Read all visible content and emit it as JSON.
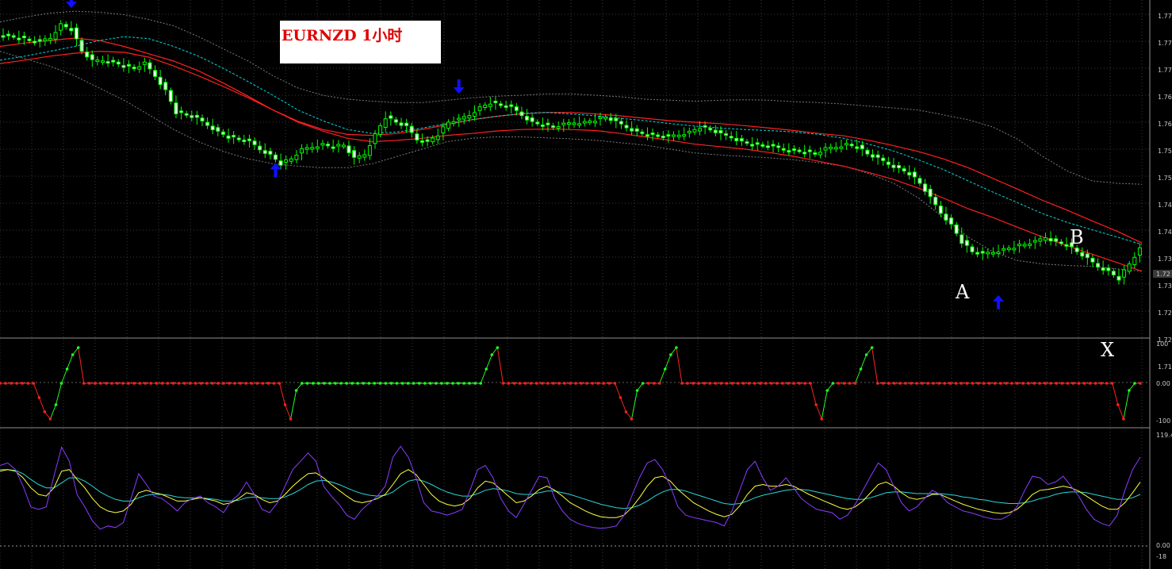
{
  "title": "EURNZD 1小时",
  "annotations": {
    "a": "A",
    "b": "B",
    "x": "X"
  },
  "colors": {
    "background": "#000000",
    "grid": "#3a3a3a",
    "candle": "#00ff00",
    "ma_red": "#ff2020",
    "ma_dashed": "#00d8d8",
    "bands": "#7a7a7a",
    "arrow": "#1010ff",
    "osc_red": "#ff2020",
    "osc_green": "#20ff20",
    "purple": "#8a3cff",
    "yellow": "#ffff40",
    "cyan": "#2ad6d6"
  },
  "chart_data": [
    {
      "type": "line",
      "name": "price",
      "title": "EURNZD 1小时",
      "y_ticks": [
        "1.77",
        "1.77",
        "1.77",
        "1.76",
        "1.76",
        "1.75",
        "1.75",
        "1.74",
        "1.74",
        "1.73",
        "1.73",
        "1.72",
        "1.72",
        "1.71"
      ],
      "current_price_label": "1.72",
      "price_path": [
        1.7725,
        1.7722,
        1.7718,
        1.7712,
        1.771,
        1.7718,
        1.7745,
        1.7735,
        1.769,
        1.767,
        1.7672,
        1.7668,
        1.766,
        1.7655,
        1.7665,
        1.764,
        1.761,
        1.7565,
        1.756,
        1.7552,
        1.754,
        1.7525,
        1.7515,
        1.751,
        1.7505,
        1.749,
        1.7478,
        1.746,
        1.747,
        1.7488,
        1.7495,
        1.75,
        1.7495,
        1.7498,
        1.747,
        1.748,
        1.752,
        1.7555,
        1.7545,
        1.7535,
        1.751,
        1.7505,
        1.752,
        1.7545,
        1.755,
        1.756,
        1.7575,
        1.7585,
        1.758,
        1.7575,
        1.756,
        1.7545,
        1.754,
        1.7535,
        1.754,
        1.7545,
        1.7545,
        1.755,
        1.7555,
        1.7545,
        1.7535,
        1.7525,
        1.752,
        1.7518,
        1.7515,
        1.752,
        1.7525,
        1.7535,
        1.753,
        1.752,
        1.7515,
        1.7505,
        1.75,
        1.7498,
        1.7495,
        1.749,
        1.7488,
        1.7485,
        1.748,
        1.749,
        1.7495,
        1.75,
        1.7495,
        1.748,
        1.747,
        1.746,
        1.745,
        1.744,
        1.742,
        1.739,
        1.736,
        1.7335,
        1.73,
        1.728,
        1.7275,
        1.728,
        1.7285,
        1.729,
        1.7295,
        1.73,
        1.731,
        1.73,
        1.7295,
        1.728,
        1.7265,
        1.725,
        1.724,
        1.7225,
        1.7255,
        1.7285
      ],
      "upper_band": [
        1.775,
        1.776,
        1.7768,
        1.7772,
        1.777,
        1.7765,
        1.7755,
        1.7742,
        1.772,
        1.7695,
        1.767,
        1.764,
        1.7615,
        1.76,
        1.7592,
        1.7588,
        1.7585,
        1.7585,
        1.759,
        1.7595,
        1.7598,
        1.76,
        1.7603,
        1.7603,
        1.76,
        1.7597,
        1.7592,
        1.759,
        1.7588,
        1.759,
        1.7591,
        1.759,
        1.7587,
        1.7585,
        1.7582,
        1.7578,
        1.7574,
        1.757,
        1.756,
        1.755,
        1.7535,
        1.751,
        1.7475,
        1.7445,
        1.7425,
        1.742,
        1.7418
      ],
      "lower_band": [
        1.769,
        1.7675,
        1.766,
        1.764,
        1.7615,
        1.759,
        1.756,
        1.753,
        1.7505,
        1.7485,
        1.747,
        1.746,
        1.7455,
        1.7452,
        1.7452,
        1.746,
        1.7475,
        1.749,
        1.7505,
        1.7512,
        1.7515,
        1.7515,
        1.7513,
        1.7511,
        1.7508,
        1.7503,
        1.7498,
        1.749,
        1.7482,
        1.7478,
        1.7475,
        1.7472,
        1.7468,
        1.7462,
        1.7455,
        1.744,
        1.742,
        1.739,
        1.735,
        1.731,
        1.728,
        1.7262,
        1.7255,
        1.7252,
        1.725,
        1.7245,
        1.724
      ],
      "ma_upper": [
        1.77,
        1.7707,
        1.7712,
        1.7717,
        1.7712,
        1.77,
        1.7685,
        1.767,
        1.765,
        1.7625,
        1.7598,
        1.757,
        1.7547,
        1.753,
        1.752,
        1.7518,
        1.7522,
        1.753,
        1.754,
        1.755,
        1.7557,
        1.7562,
        1.7565,
        1.7565,
        1.7562,
        1.7558,
        1.7553,
        1.7548,
        1.7545,
        1.7542,
        1.7538,
        1.7533,
        1.7528,
        1.7522,
        1.7517,
        1.7508,
        1.7497,
        1.7485,
        1.747,
        1.7452,
        1.743,
        1.7408,
        1.7385,
        1.7365,
        1.7343,
        1.7322,
        1.7298
      ],
      "ma_lower": [
        1.7665,
        1.7672,
        1.768,
        1.7686,
        1.769,
        1.7688,
        1.7678,
        1.766,
        1.764,
        1.7618,
        1.7595,
        1.757,
        1.7545,
        1.7527,
        1.7512,
        1.7505,
        1.7508,
        1.7512,
        1.7518,
        1.7522,
        1.7527,
        1.753,
        1.7531,
        1.753,
        1.7528,
        1.7522,
        1.7515,
        1.7508,
        1.75,
        1.7495,
        1.749,
        1.7483,
        1.7475,
        1.7465,
        1.7455,
        1.7442,
        1.7428,
        1.741,
        1.739,
        1.7368,
        1.735,
        1.733,
        1.731,
        1.7292,
        1.7275,
        1.7258,
        1.724
      ],
      "ma_dashed": [
        1.7672,
        1.768,
        1.769,
        1.77,
        1.7712,
        1.772,
        1.7716,
        1.77,
        1.768,
        1.7655,
        1.7628,
        1.76,
        1.757,
        1.7548,
        1.753,
        1.7522,
        1.7525,
        1.7533,
        1.7542,
        1.755,
        1.7557,
        1.7563,
        1.7565,
        1.7562,
        1.7558,
        1.7553,
        1.7548,
        1.7542,
        1.7537,
        1.7533,
        1.753,
        1.7528,
        1.7525,
        1.752,
        1.7512,
        1.75,
        1.7486,
        1.7468,
        1.7448,
        1.7425,
        1.7402,
        1.738,
        1.7358,
        1.734,
        1.7325,
        1.731,
        1.7295
      ],
      "signals": [
        {
          "type": "down",
          "x_index": 13,
          "price": 1.7785
        },
        {
          "type": "up",
          "x_index": 52,
          "price": 1.7455
        },
        {
          "type": "down",
          "x_index": 87,
          "price": 1.761
        },
        {
          "type": "up",
          "x_index": 190,
          "price": 1.7185
        }
      ]
    },
    {
      "type": "line",
      "name": "oscillator",
      "ylim": [
        -100,
        100
      ],
      "y_ticks": [
        "100",
        "0.00",
        "-100"
      ],
      "values": [
        0,
        0,
        0,
        0,
        0,
        0,
        0,
        -40,
        -80,
        -100,
        -60,
        0,
        40,
        80,
        100,
        0,
        0,
        0,
        0,
        0,
        0,
        0,
        0,
        0,
        0,
        0,
        0,
        0,
        0,
        0,
        0,
        0,
        0,
        0,
        0,
        0,
        0,
        0,
        0,
        0,
        0,
        0,
        0,
        0,
        0,
        0,
        0,
        0,
        0,
        0,
        0,
        -60,
        -100,
        -20,
        0,
        0,
        0,
        0,
        0,
        0,
        0,
        0,
        0,
        0,
        0,
        0,
        0,
        0,
        0,
        0,
        0,
        0,
        0,
        0,
        0,
        0,
        0,
        0,
        0,
        0,
        0,
        0,
        0,
        0,
        0,
        0,
        0,
        40,
        80,
        100,
        0,
        0,
        0,
        0,
        0,
        0,
        0,
        0,
        0,
        0,
        0,
        0,
        0,
        0,
        0,
        0,
        0,
        0,
        0,
        0,
        0,
        -40,
        -80,
        -100,
        -20,
        0,
        0,
        0,
        0,
        40,
        80,
        100,
        0,
        0,
        0,
        0,
        0,
        0,
        0,
        0,
        0,
        0,
        0,
        0,
        0,
        0,
        0,
        0,
        0,
        0,
        0,
        0,
        0,
        0,
        0,
        0,
        -60,
        -100,
        -20,
        0,
        0,
        0,
        0,
        0,
        40,
        80,
        100,
        0,
        0,
        0,
        0,
        0,
        0,
        0,
        0,
        0,
        0,
        0,
        0,
        0,
        0,
        0,
        0,
        0,
        0,
        0,
        0,
        0,
        0,
        0,
        0,
        0,
        0,
        0,
        0,
        0,
        0,
        0,
        0,
        0,
        0,
        0,
        0,
        0,
        0,
        0,
        0,
        0,
        0,
        0,
        -60,
        -100,
        -20,
        0,
        0
      ]
    },
    {
      "type": "line",
      "name": "stochastic",
      "ylim": [
        -18,
        119
      ],
      "y_ticks": [
        "119.4",
        "0.00",
        "-18"
      ],
      "purple": [
        85,
        88,
        80,
        60,
        35,
        32,
        35,
        72,
        107,
        90,
        50,
        35,
        18,
        8,
        12,
        10,
        16,
        45,
        75,
        62,
        48,
        45,
        38,
        30,
        40,
        45,
        48,
        40,
        35,
        28,
        42,
        50,
        65,
        50,
        32,
        28,
        40,
        60,
        80,
        90,
        100,
        90,
        60,
        48,
        38,
        25,
        20,
        32,
        40,
        48,
        60,
        95,
        108,
        95,
        70,
        40,
        30,
        28,
        25,
        28,
        32,
        55,
        80,
        85,
        70,
        45,
        30,
        22,
        38,
        55,
        72,
        70,
        45,
        30,
        20,
        15,
        12,
        10,
        9,
        10,
        12,
        25,
        48,
        70,
        88,
        92,
        80,
        60,
        35,
        25,
        22,
        20,
        18,
        16,
        12,
        30,
        55,
        80,
        90,
        70,
        55,
        60,
        70,
        58,
        45,
        38,
        32,
        30,
        28,
        20,
        25,
        38,
        55,
        72,
        88,
        80,
        60,
        40,
        30,
        35,
        45,
        55,
        50,
        40,
        35,
        30,
        28,
        25,
        22,
        20,
        20,
        25,
        35,
        55,
        72,
        70,
        62,
        65,
        72,
        60,
        48,
        32,
        20,
        15,
        12,
        25,
        55,
        80,
        95
      ],
      "yellow": [
        78,
        80,
        78,
        70,
        58,
        50,
        48,
        58,
        78,
        80,
        68,
        58,
        45,
        35,
        30,
        28,
        30,
        38,
        52,
        55,
        52,
        50,
        46,
        42,
        42,
        44,
        46,
        44,
        42,
        38,
        40,
        45,
        52,
        50,
        44,
        40,
        42,
        50,
        60,
        68,
        75,
        76,
        70,
        62,
        55,
        48,
        42,
        40,
        42,
        45,
        50,
        62,
        75,
        80,
        74,
        62,
        50,
        42,
        38,
        36,
        38,
        45,
        58,
        66,
        64,
        56,
        48,
        40,
        42,
        48,
        56,
        60,
        55,
        48,
        40,
        35,
        30,
        26,
        23,
        22,
        22,
        25,
        34,
        46,
        60,
        70,
        72,
        66,
        56,
        48,
        40,
        35,
        30,
        26,
        23,
        26,
        36,
        50,
        60,
        62,
        60,
        60,
        62,
        60,
        55,
        50,
        46,
        42,
        38,
        34,
        32,
        35,
        42,
        52,
        62,
        65,
        60,
        52,
        46,
        44,
        46,
        50,
        50,
        46,
        42,
        38,
        35,
        32,
        30,
        28,
        27,
        28,
        32,
        40,
        50,
        55,
        56,
        58,
        60,
        58,
        54,
        48,
        42,
        36,
        32,
        32,
        40,
        52,
        65
      ],
      "cyan": [
        80,
        80,
        79,
        75,
        68,
        62,
        58,
        58,
        64,
        70,
        70,
        66,
        60,
        53,
        48,
        44,
        42,
        42,
        46,
        49,
        50,
        50,
        49,
        47,
        46,
        46,
        46,
        45,
        44,
        42,
        42,
        43,
        46,
        47,
        46,
        45,
        45,
        47,
        51,
        56,
        62,
        66,
        67,
        65,
        62,
        58,
        54,
        51,
        49,
        48,
        49,
        53,
        60,
        66,
        68,
        66,
        62,
        57,
        53,
        50,
        48,
        48,
        51,
        55,
        57,
        56,
        54,
        51,
        50,
        50,
        52,
        54,
        54,
        52,
        50,
        47,
        44,
        41,
        38,
        36,
        34,
        33,
        34,
        37,
        42,
        48,
        53,
        56,
        56,
        54,
        51,
        48,
        45,
        42,
        39,
        38,
        39,
        42,
        46,
        49,
        51,
        53,
        55,
        56,
        56,
        55,
        53,
        51,
        49,
        47,
        45,
        44,
        44,
        46,
        49,
        52,
        53,
        53,
        52,
        51,
        51,
        51,
        51,
        50,
        49,
        47,
        46,
        44,
        43,
        41,
        40,
        39,
        39,
        40,
        42,
        45,
        47,
        50,
        52,
        53,
        53,
        52,
        50,
        48,
        46,
        44,
        44,
        46,
        50
      ]
    }
  ]
}
